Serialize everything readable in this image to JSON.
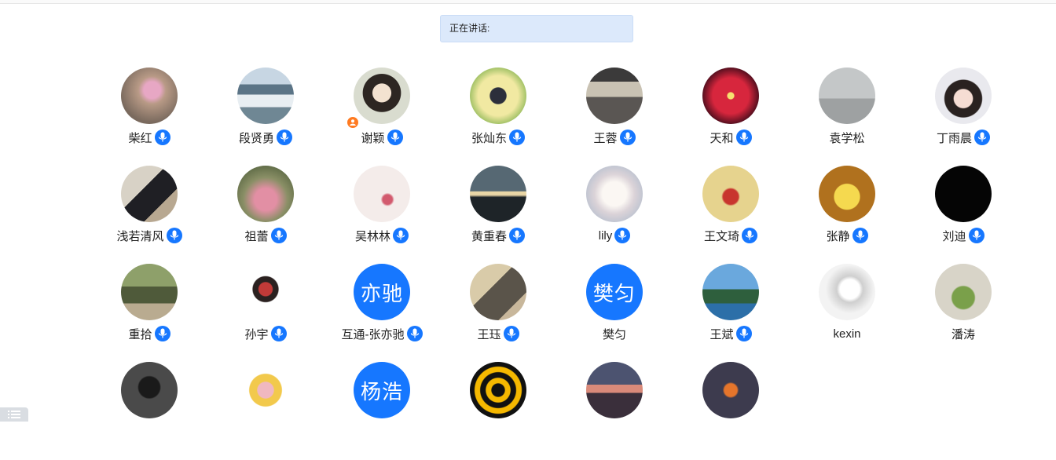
{
  "banner": {
    "label": "正在讲话:"
  },
  "participants": [
    {
      "name": "柴红",
      "mic": true,
      "bg": "radial-gradient(circle at 55% 40%, #e7a7c4 0 18%, #b89a86 30%, #7a6a5e 70%)"
    },
    {
      "name": "段贤勇",
      "mic": true,
      "bg": "linear-gradient(#c7d6e3 0 30%, #5b7486 30% 48%, #e8eef2 48% 70%, #6f8794 70%)"
    },
    {
      "name": "谢颖",
      "mic": true,
      "host": true,
      "bg": "radial-gradient(circle at 50% 45%, #f3e2d0 0 22%, #2d2622 23% 45%, #d9dccf 46%)"
    },
    {
      "name": "张灿东",
      "mic": true,
      "bg": "radial-gradient(circle at 50% 50%, #2c2f3b 0 20%, #f1e9a2 22% 50%, #a7c46a 70%)"
    },
    {
      "name": "王蓉",
      "mic": true,
      "bg": "linear-gradient(#3b3a3a 0 25%, #c9c2b3 25% 52%, #5a5653 52% 100%)"
    },
    {
      "name": "天和",
      "mic": true,
      "bg": "radial-gradient(circle at 50% 50%, #f6e070 0 8%, #d7263d 10% 45%, #5a1020 70%)"
    },
    {
      "name": "袁学松",
      "mic": false,
      "bg": "linear-gradient(#c4c7c8 0 55%, #9ea1a2 55%)"
    },
    {
      "name": "丁雨晨",
      "mic": true,
      "bg": "radial-gradient(circle at 50% 55%, #f6ddd3 0 22%, #2a2220 24% 44%, #e9e9ee 46%)"
    },
    {
      "name": "浅若清风",
      "mic": true,
      "bg": "linear-gradient(135deg, #d8d2c6 0 40%, #1f1f24 40% 70%, #b8a891 70%)"
    },
    {
      "name": "祖蕾",
      "mic": true,
      "bg": "radial-gradient(circle at 50% 60%, #e28fa4 0 25%, #8a8f66 50%, #5d6a45 80%)"
    },
    {
      "name": "吴林林",
      "mic": true,
      "bg": "radial-gradient(circle at 60% 60%, #d25a6e 0 10%, #f4ecea 14% 100%)"
    },
    {
      "name": "黄重春",
      "mic": true,
      "bg": "linear-gradient(#566873 0 45%, #e9d6a6 46% 52%, #1e2428 56%)"
    },
    {
      "name": "lily",
      "mic": true,
      "bg": "radial-gradient(circle at 50% 50%, #fbf7f3 0 30%, #dbd3d8 50%, #b7c0cf 80%)"
    },
    {
      "name": "王文琦",
      "mic": true,
      "bg": "radial-gradient(circle at 50% 55%, #c8352e 0 18%, #e6d38e 22% 100%)"
    },
    {
      "name": "张静",
      "mic": true,
      "bg": "radial-gradient(circle at 50% 55%, #f5d94f 0 30%, #b0711e 32% 100%)"
    },
    {
      "name": "刘迪",
      "mic": true,
      "bg": "#050505"
    },
    {
      "name": "重拾",
      "mic": true,
      "bg": "linear-gradient(#8ea06a 0 40%, #4f5a3a 40% 70%, #b9ab90 70%)"
    },
    {
      "name": "孙宇",
      "mic": true,
      "bg": "radial-gradient(circle at 50% 45%, #c23a38 0 16%, #2b2120 18% 30%, #ffffff 32%)"
    },
    {
      "name": "互通-张亦驰",
      "mic": true,
      "text": "亦驰",
      "bg": "#1677ff"
    },
    {
      "name": "王珏",
      "mic": true,
      "bg": "linear-gradient(135deg, #d9cba9 0 40%, #5a544a 40% 75%, #c8b79b 75%)"
    },
    {
      "name": "樊匀",
      "mic": false,
      "text": "樊匀",
      "bg": "#1677ff"
    },
    {
      "name": "王斌",
      "mic": true,
      "bg": "linear-gradient(#6aa8dd 0 45%, #2e5f3d 45% 70%, #2c6fa8 70%)"
    },
    {
      "name": "kexin",
      "mic": false,
      "bg": "radial-gradient(circle at 55% 45%, #ffffff 0 22%, #cfcfcf 30%, #f3f3f3 55%)"
    },
    {
      "name": "潘涛",
      "mic": false,
      "bg": "radial-gradient(circle at 50% 60%, #7aa04a 0 25%, #d8d4c8 28% 100%)"
    },
    {
      "name": "",
      "mic": false,
      "bg": "radial-gradient(circle at 50% 45%, #1a1a1a 0 25%, #4a4a4a 28% 100%)"
    },
    {
      "name": "",
      "mic": false,
      "bg": "radial-gradient(circle at 50% 50%, #f0b8c0 0 20%, #f2c94c 22% 40%, #ffffff 42%)"
    },
    {
      "name": "",
      "mic": false,
      "text": "杨浩",
      "bg": "#1677ff"
    },
    {
      "name": "",
      "mic": false,
      "bg": "radial-gradient(circle at 50% 50%, #111 0 16%, #f5b800 18% 30%, #111 32% 44%, #f5b800 46% 58%, #111 60%)"
    },
    {
      "name": "",
      "mic": false,
      "bg": "linear-gradient(#4c5370 0 40%, #d98a7a 40% 55%, #3a2f3b 55%)"
    },
    {
      "name": "",
      "mic": false,
      "bg": "radial-gradient(circle at 50% 50%, #e5752b 0 16%, #3d3b4e 20% 100%)"
    }
  ]
}
